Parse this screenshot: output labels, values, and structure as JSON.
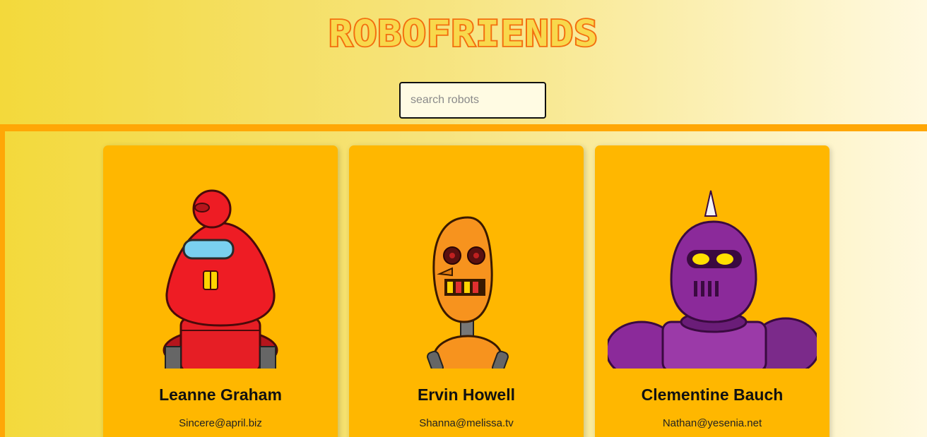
{
  "app": {
    "title": "ROBOFRIENDS"
  },
  "search": {
    "placeholder": "search robots",
    "value": ""
  },
  "robots": [
    {
      "name": "Leanne Graham",
      "email": "Sincere@april.biz",
      "color": "#ee1c24"
    },
    {
      "name": "Ervin Howell",
      "email": "Shanna@melissa.tv",
      "color": "#f7931e"
    },
    {
      "name": "Clementine Bauch",
      "email": "Nathan@yesenia.net",
      "color": "#7b2a8a"
    }
  ],
  "colors": {
    "card": "#ffb700",
    "accent_border": "#ffa706",
    "title_stroke": "#f36f0f"
  }
}
